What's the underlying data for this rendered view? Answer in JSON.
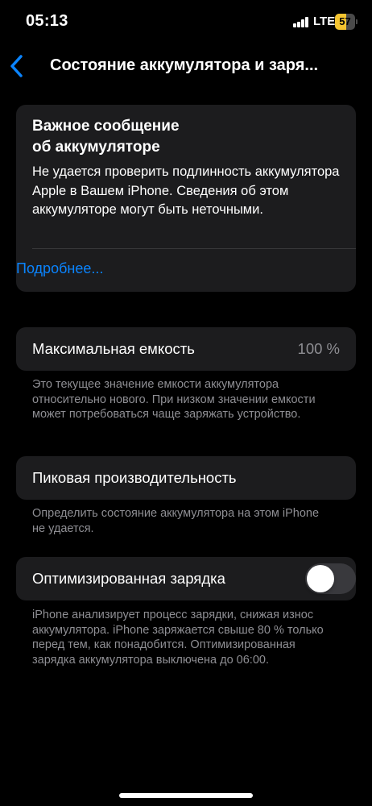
{
  "status_bar": {
    "time": "05:13",
    "network": "LTE",
    "battery": "57",
    "battery_level": 0.57,
    "battery_color": "#f4c430"
  },
  "nav": {
    "back_icon": "chevron-left-icon",
    "title": "Состояние аккумулятора и заря..."
  },
  "alert": {
    "title_line1": "Важное сообщение",
    "title_line2": "об аккумуляторе",
    "body": "Не удается проверить подлинность аккумулятора Apple в Вашем iPhone. Сведения об этом аккумуляторе могут быть неточными.",
    "link": "Подробнее..."
  },
  "max_capacity": {
    "label": "Максимальная емкость",
    "value": "100 %",
    "footnote": "Это текущее значение емкости аккумулятора относительно нового. При низком значении емкости может потребоваться чаще заряжать устройство."
  },
  "peak_performance": {
    "label": "Пиковая производительность",
    "footnote": "Определить состояние аккумулятора на этом iPhone не удается."
  },
  "optimized_charging": {
    "label": "Оптимизированная зарядка",
    "enabled": false,
    "footnote": "iPhone анализирует процесс зарядки, снижая износ аккумулятора. iPhone заряжается свыше 80 % только перед тем, как понадобится. Оптимизированная зарядка аккумулятора выключена до 06:00."
  },
  "colors": {
    "background": "#000000",
    "card": "#1c1c1e",
    "link": "#0a84ff",
    "secondary_text": "#8e8e93"
  }
}
